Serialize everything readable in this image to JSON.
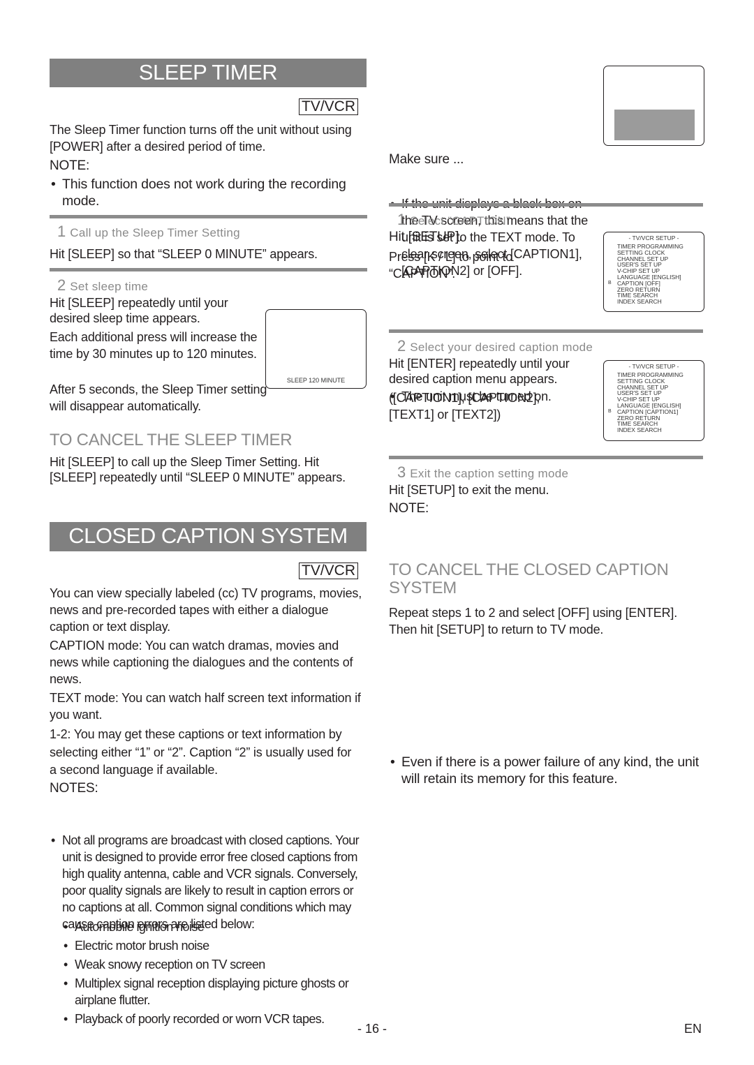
{
  "sleep_timer": {
    "title": "SLEEP TIMER",
    "badge": "TV/VCR",
    "intro": "The Sleep Timer function turns off the unit without using [POWER] after a desired period of time.",
    "note_label": "NOTE:",
    "note": "This function does not work during the recording mode.",
    "steps": [
      {
        "number": "1",
        "title": "Call up the Sleep Timer Setting",
        "body": "Hit [SLEEP] so that “SLEEP 0 MINUTE” appears."
      },
      {
        "number": "2",
        "title": "Set sleep time",
        "body": "Hit [SLEEP] repeatedly until your desired sleep time appears.",
        "body2": "Each additional press will increase the time by 30 minutes up to 120 minutes.",
        "body3": "After 5 seconds, the Sleep Timer setting will disappear automatically.",
        "screen_text": "SLEEP 120 MINUTE"
      }
    ],
    "cancel_heading": "TO CANCEL THE SLEEP TIMER",
    "cancel_body": "Hit [SLEEP] to call up the Sleep Timer Setting. Hit [SLEEP] repeatedly until “SLEEP 0 MINUTE” appears."
  },
  "closed_caption": {
    "title": "CLOSED CAPTION SYSTEM",
    "badge": "TV/VCR",
    "intro": "You can view specially labeled (cc) TV programs, movies, news and pre-recorded tapes with either a dialogue caption or text display.",
    "caption_mode": "CAPTION mode: You can watch dramas, movies and news while captioning the dialogues and the contents of news.",
    "text_mode": "TEXT mode: You can watch half screen text information if you want.",
    "one_two": "1-2: You may get these captions or text information by selecting either “1” or “2”. Caption “2” is usually used for a second language if available.",
    "notes_label": "NOTES:",
    "notes_main": "Not all programs are broadcast with closed captions. Your unit is designed to provide error free closed captions from high quality antenna, cable and VCR signals. Conversely, poor quality signals are likely to result in caption errors or no captions at all. Common signal conditions which may cause caption errors are listed below:",
    "conditions": [
      "Automobile ignition noise",
      "Electric motor brush noise",
      "Weak snowy reception on TV screen",
      "Multiplex signal reception displaying picture ghosts or airplane flutter.",
      "Playback of poorly recorded or worn VCR tapes."
    ],
    "black_box_note": "If the unit displays a black box on the TV screen, this means that the unit is set to the TEXT mode. To clear screen, select [CAPTION1], [CAPTION2] or [OFF].",
    "make_sure_label": "Make sure ...",
    "make_sure": "The unit must be turned on.",
    "steps": [
      {
        "number": "1",
        "title": "Select “CAPTION”",
        "body": "Hit [SETUP].",
        "body2": "Press [K / L] to point to “CAPTION”."
      },
      {
        "number": "2",
        "title": "Select your desired caption mode",
        "body": "Hit [ENTER] repeatedly until your desired caption menu appears.",
        "body2": "([CAPTION1], [CAPTION2], [TEXT1] or [TEXT2])"
      },
      {
        "number": "3",
        "title": "Exit the caption setting mode",
        "body": "Hit [SETUP] to exit the menu."
      }
    ],
    "note_label": "NOTE:",
    "note": "Even if there is a power failure of any kind, the unit will retain its memory for this feature.",
    "cancel_heading": "TO CANCEL THE CLOSED CAPTION SYSTEM",
    "cancel_body": "Repeat steps 1 to 2 and select [OFF] using [ENTER]. Then hit [SETUP] to return to TV mode."
  },
  "osd_menu_1": {
    "title": "- TV/VCR SETUP -",
    "cursor": "B",
    "items": [
      "TIMER PROGRAMMING",
      "SETTING CLOCK",
      "CHANNEL SET UP",
      "USER'S SET UP",
      "V-CHIP SET UP",
      "LANGUAGE  [ENGLISH]",
      "CAPTION  [OFF]",
      "ZERO RETURN",
      "TIME SEARCH",
      "INDEX SEARCH"
    ]
  },
  "osd_menu_2": {
    "title": "- TV/VCR SETUP -",
    "cursor": "B",
    "items": [
      "TIMER PROGRAMMING",
      "SETTING CLOCK",
      "CHANNEL SET UP",
      "USER'S SET UP",
      "V-CHIP SET UP",
      "LANGUAGE  [ENGLISH]",
      "CAPTION  [CAPTION1]",
      "ZERO RETURN",
      "TIME SEARCH",
      "INDEX SEARCH"
    ]
  },
  "footer": {
    "page_number": "- 16 -",
    "language": "EN"
  }
}
